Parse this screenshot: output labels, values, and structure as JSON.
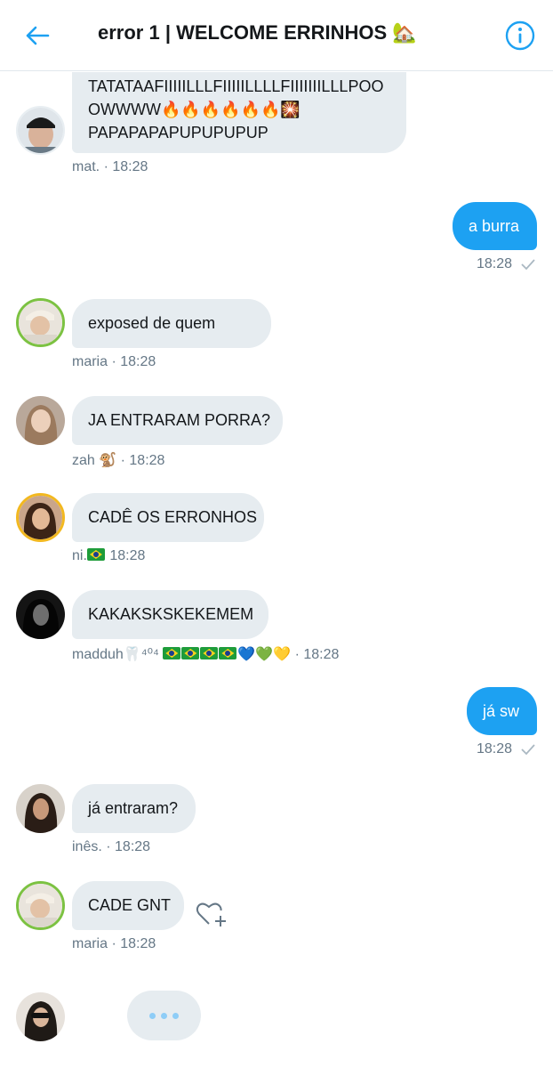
{
  "header": {
    "title": "error 1 | WELCOME ERRINHOS 🏡",
    "back_icon": "back-arrow-icon",
    "info_icon": "info-icon",
    "accent_color": "#1da1f2"
  },
  "messages": [
    {
      "sender": "mat.",
      "lines": [
        "TATATAAFIIIIILLLFIIIIILLLLFIIIIIIILLLPOO",
        "OWWWW🔥🔥🔥🔥🔥🔥🎇",
        "PAPAPAPAPUPUPUPUP"
      ],
      "meta": "mat. · 18:28"
    },
    {
      "direction": "out",
      "text": "a burra",
      "time": "18:28"
    },
    {
      "sender": "maria",
      "text": "exposed de quem",
      "meta": "maria · 18:28"
    },
    {
      "sender": "zah",
      "text": "JA ENTRARAM PORRA?",
      "meta_name": "zah 🐒",
      "meta_time": "· 18:28"
    },
    {
      "sender": "ni.",
      "text": "CADÊ OS ERRONHOS",
      "meta_name": "ni.",
      "meta_time": "18:28"
    },
    {
      "sender": "madduh",
      "text": "KAKAKSKSKEKEMEM",
      "meta_name": "madduh🦷⁴⁰⁴",
      "meta_hearts": "💙💚💛",
      "meta_time": "· 18:28"
    },
    {
      "direction": "out",
      "text": "já sw",
      "time": "18:28"
    },
    {
      "sender": "inês.",
      "text": "já entraram?",
      "meta": "inês. · 18:28"
    },
    {
      "sender": "maria",
      "text": "CADE GNT",
      "meta": "maria · 18:28"
    }
  ],
  "typing_indicator": "typing-dots"
}
